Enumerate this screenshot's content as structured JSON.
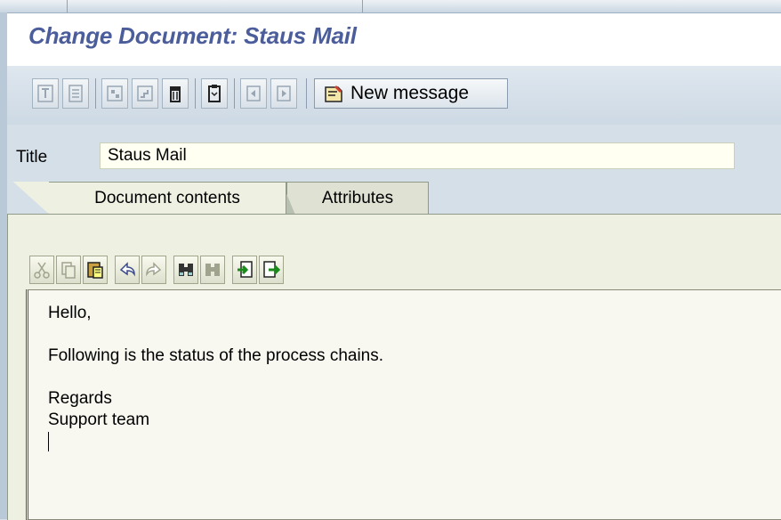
{
  "window": {
    "title": "Change Document: Staus Mail"
  },
  "toolbar": {
    "new_message_label": "New message",
    "icons": [
      "display-icon",
      "outline-icon",
      "add-icon",
      "tree-icon",
      "trash-icon",
      "clipboard-icon",
      "prev-icon",
      "next-icon",
      "new-message-icon"
    ]
  },
  "document": {
    "title_label": "Title",
    "title_value": "Staus Mail"
  },
  "tabs": [
    {
      "label": "Document contents",
      "active": true
    },
    {
      "label": "Attributes",
      "active": false
    }
  ],
  "editor_toolbar": {
    "icons": [
      "cut-icon",
      "copy-icon",
      "paste-icon",
      "undo-icon",
      "redo-icon",
      "find-icon",
      "find-next-icon",
      "import-icon",
      "export-icon"
    ]
  },
  "editor": {
    "lines": [
      "Hello,",
      "",
      "Following is the status of the process chains.",
      "",
      "Regards",
      "Support team",
      ""
    ]
  },
  "colors": {
    "title_text": "#4b5d9a",
    "background": "#d5dfe8",
    "panel": "#eef0e2",
    "input_bg": "#fffff2"
  }
}
